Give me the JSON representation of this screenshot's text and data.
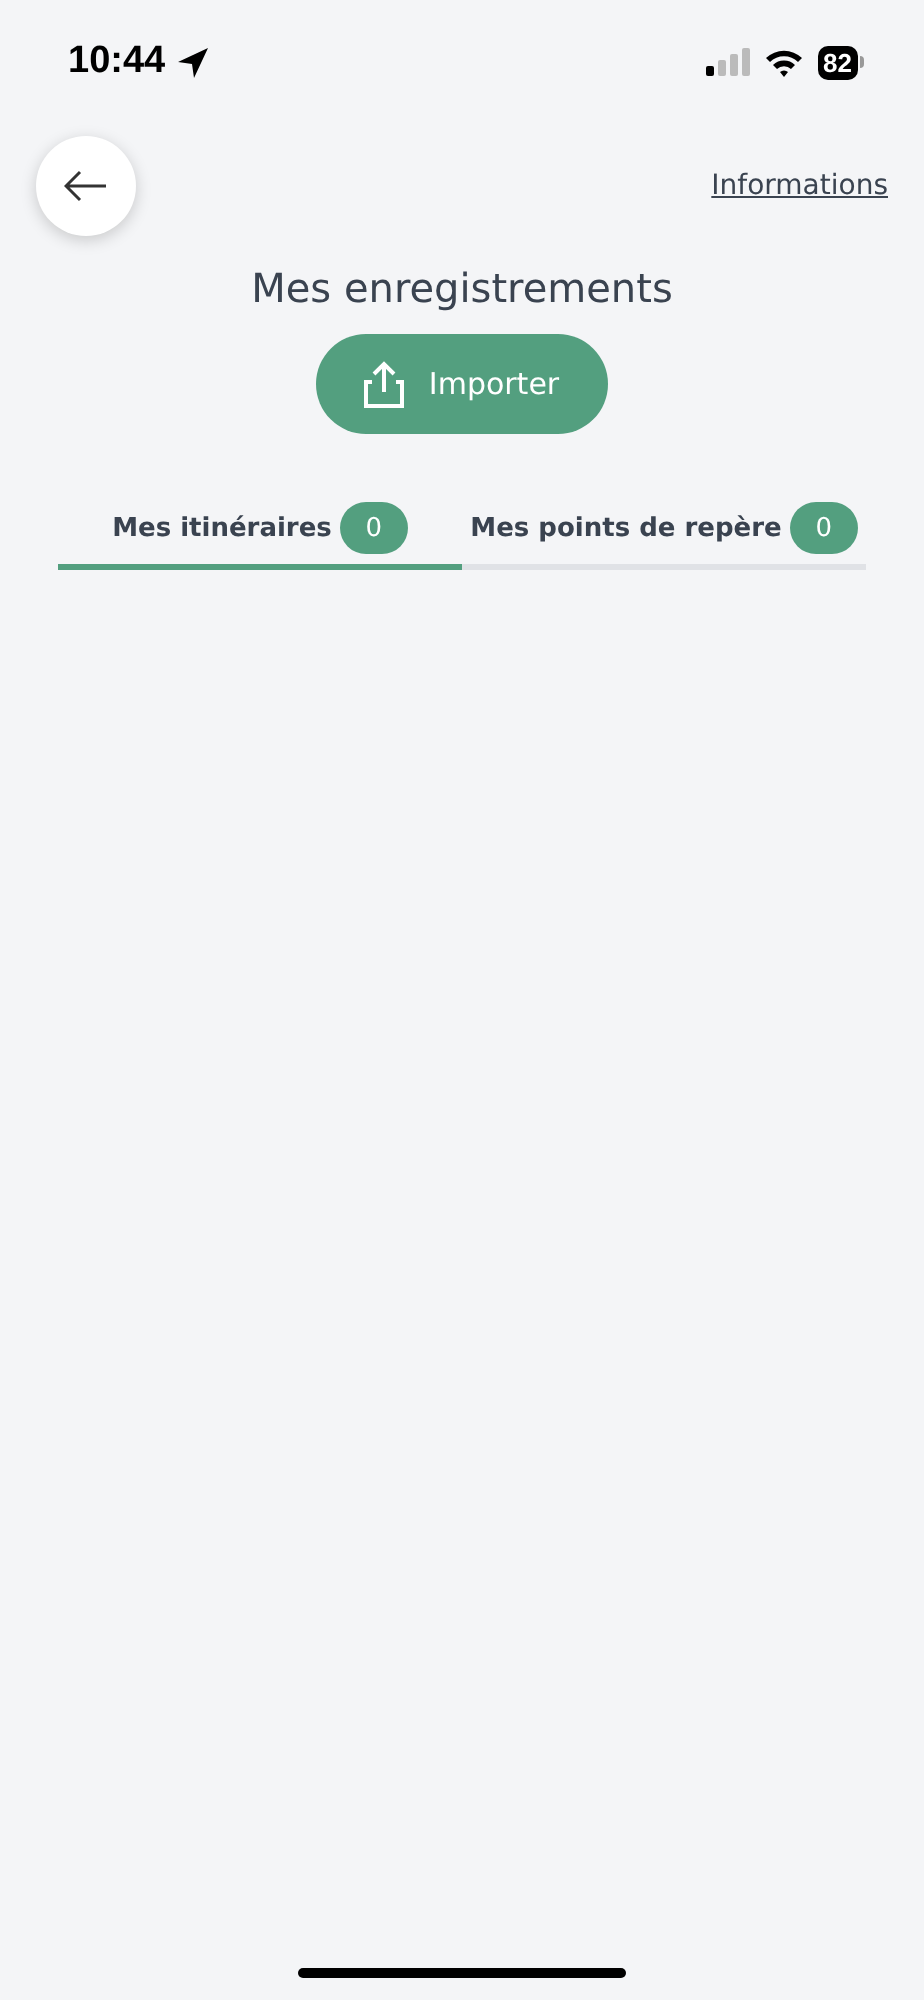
{
  "status_bar": {
    "time": "10:44",
    "battery": "82"
  },
  "header": {
    "link": "Informations"
  },
  "title": "Mes enregistrements",
  "import_button": {
    "label": "Importer"
  },
  "tabs": [
    {
      "label": "Mes itinéraires",
      "count": "0",
      "selected": true
    },
    {
      "label": "Mes points de repère",
      "count": "0",
      "selected": false
    }
  ]
}
